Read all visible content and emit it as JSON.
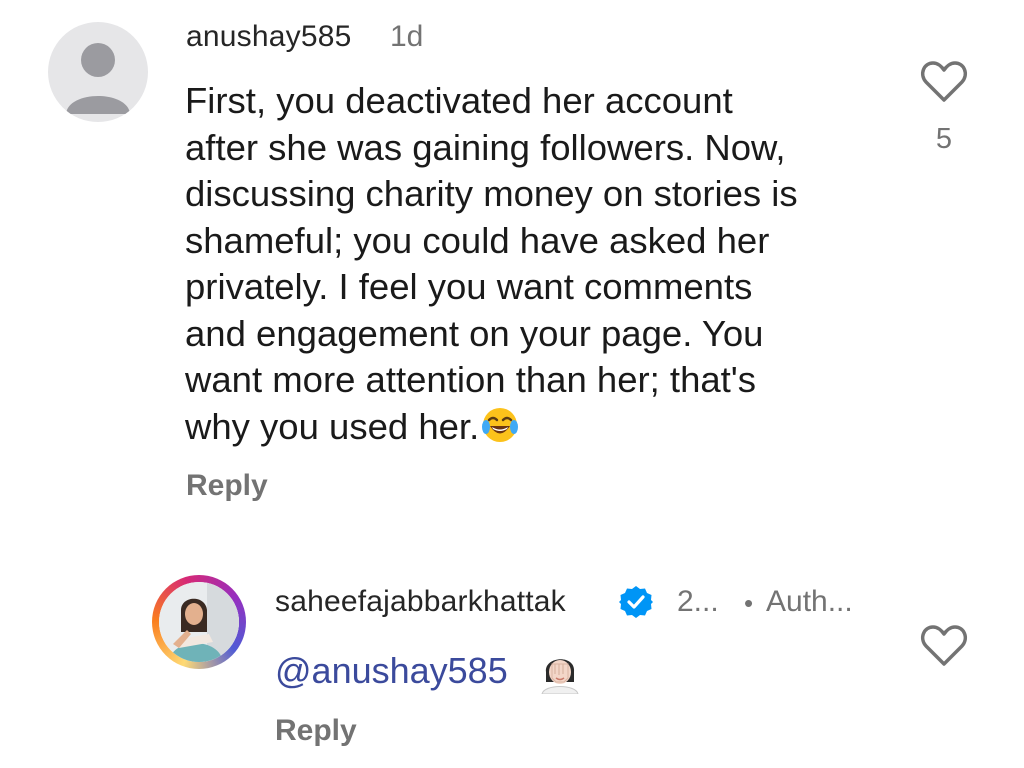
{
  "comment1": {
    "username": "anushay585",
    "timestamp": "1d",
    "text": "First, you deactivated her account\nafter she was gaining followers. Now,\ndiscussing charity money on stories is\nshameful; you could have asked her\nprivately. I feel you want comments\nand engagement on your page. You\nwant more attention than her; that's\nwhy you used her.",
    "emoji": "laughing-with-tears",
    "like_count": "5",
    "reply_label": "Reply",
    "avatar": "default-avatar-icon"
  },
  "reply1": {
    "username": "saheefajabbarkhattak",
    "timestamp": "2...",
    "separator": "•",
    "author_tag": "Auth...",
    "mention": "@anushay585",
    "emoji": "facepalm",
    "reply_label": "Reply",
    "verified": true
  },
  "colors": {
    "secondary_text": "#737373",
    "mention": "#3b4a9c",
    "verified_badge": "#0095f6"
  }
}
